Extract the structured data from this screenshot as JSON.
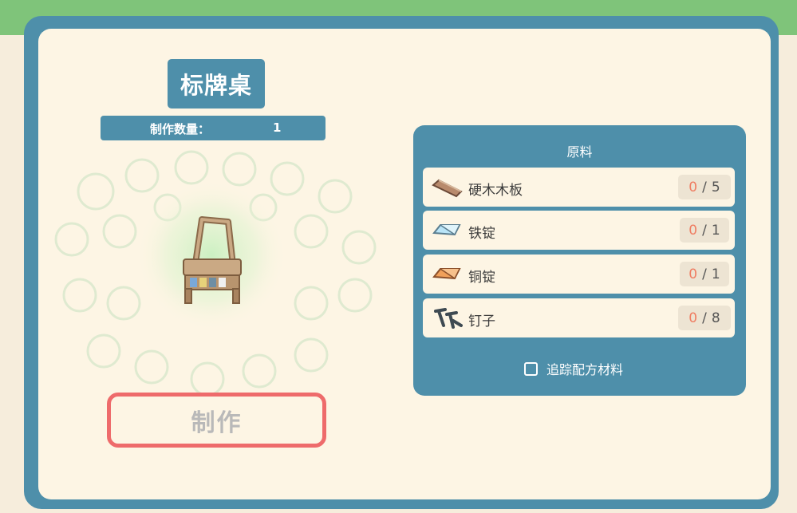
{
  "item": {
    "title": "标牌桌",
    "quantity_label": "制作数量：",
    "quantity_value": "1"
  },
  "craft_button": {
    "label": "制作"
  },
  "materials_panel": {
    "title": "原料",
    "items": [
      {
        "name": "硬木木板",
        "have": "0",
        "separator": "/",
        "need": "5",
        "icon": "hardwood-plank-icon"
      },
      {
        "name": "铁锭",
        "have": "0",
        "separator": "/",
        "need": "1",
        "icon": "iron-ingot-icon"
      },
      {
        "name": "铜锭",
        "have": "0",
        "separator": "/",
        "need": "1",
        "icon": "copper-ingot-icon"
      },
      {
        "name": "钉子",
        "have": "0",
        "separator": "/",
        "need": "8",
        "icon": "nails-icon"
      }
    ],
    "track_label": "追踪配方材料",
    "track_checked": false
  },
  "colors": {
    "frame": "#4e8faa",
    "panel_bg": "#fdf5e4",
    "accent_red": "#ee6b6b",
    "count_have": "#ef7e63",
    "grass": "#7fc47a"
  }
}
